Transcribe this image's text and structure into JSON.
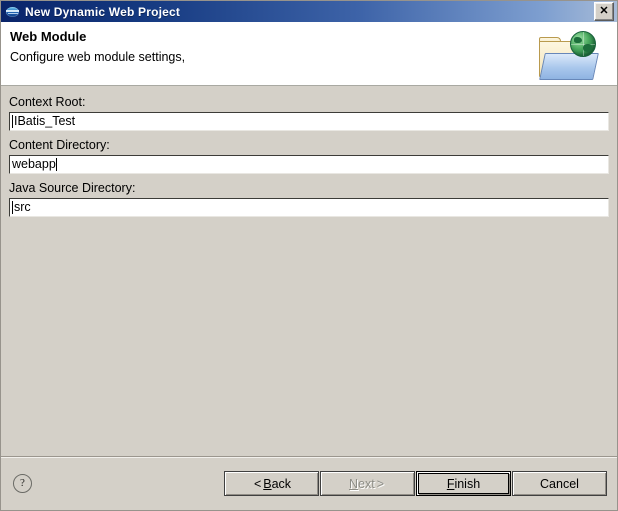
{
  "window": {
    "title": "New Dynamic Web Project",
    "icon": "eclipse-icon",
    "close_label": "✕"
  },
  "header": {
    "title": "Web Module",
    "subtitle": "Configure web module settings,",
    "icon": "web-folder-globe-icon"
  },
  "form": {
    "fields": [
      {
        "label": "Context Root:",
        "value": "IBatis_Test",
        "caret": "leading",
        "name": "context-root"
      },
      {
        "label": "Content Directory:",
        "value": "webapp",
        "caret": "trailing",
        "name": "content-directory"
      },
      {
        "label": "Java Source Directory:",
        "value": "src",
        "caret": "leading",
        "name": "java-source-directory"
      }
    ]
  },
  "footer": {
    "help_label": "?",
    "buttons": [
      {
        "name": "back",
        "prefix": "<",
        "accel": "B",
        "rest": "ack",
        "suffix": "",
        "state": "enabled",
        "default": false
      },
      {
        "name": "next",
        "prefix": "",
        "accel": "N",
        "rest": "ext",
        "suffix": ">",
        "state": "disabled",
        "default": false
      },
      {
        "name": "finish",
        "prefix": "",
        "accel": "F",
        "rest": "inish",
        "suffix": "",
        "state": "enabled",
        "default": true
      },
      {
        "name": "cancel",
        "prefix": "",
        "accel": "",
        "rest": "Cancel",
        "suffix": "",
        "state": "enabled",
        "default": false
      }
    ]
  },
  "colors": {
    "dialog_bg": "#d4d0c8",
    "titlebar_start": "#0a246a",
    "titlebar_end": "#a8bcd8",
    "header_bg": "#ffffff",
    "input_bg": "#ffffff",
    "text": "#000000",
    "disabled_text": "#8d8d86"
  }
}
